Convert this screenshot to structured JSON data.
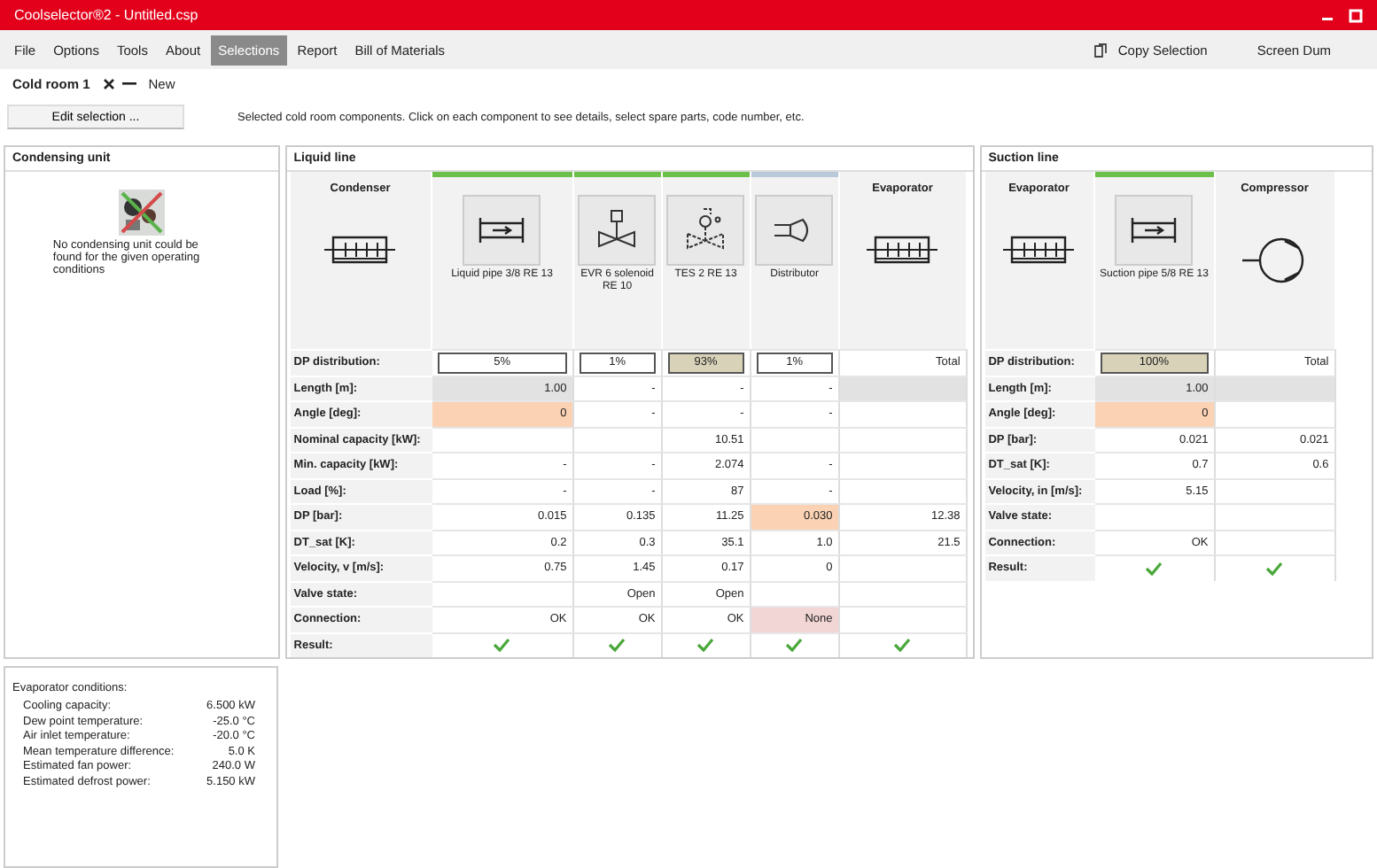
{
  "window": {
    "title": "Coolselector®2 - Untitled.csp"
  },
  "menu": [
    {
      "label": "File",
      "selected": false
    },
    {
      "label": "Options",
      "selected": false
    },
    {
      "label": "Tools",
      "selected": false
    },
    {
      "label": "About",
      "selected": false
    },
    {
      "label": "Selections",
      "selected": true
    },
    {
      "label": "Report",
      "selected": false
    },
    {
      "label": "Bill of Materials",
      "selected": false
    }
  ],
  "menu_actions": [
    "Copy Selection",
    "Screen Dum"
  ],
  "doc_tabs": [
    {
      "label": "Cold room 1",
      "selected": true
    },
    {
      "label": "New",
      "selected": false
    }
  ],
  "edit_button": "Edit selection ...",
  "hint": "Selected cold room components. Click on each component to see details, select spare parts, code number, etc.",
  "condensing_unit": {
    "title": "Condensing unit",
    "message": "No condensing unit could be found for the given operating conditions"
  },
  "sections": [
    {
      "title": "Liquid line",
      "components": [
        {
          "kind": "condenser",
          "name": "Condenser"
        },
        {
          "kind": "pipe",
          "name": "Liquid pipe 3/8 RE 13",
          "color": "#6cc04a"
        },
        {
          "kind": "valve",
          "name": "EVR 6 solenoid RE 10",
          "color": "#6cc04a"
        },
        {
          "kind": "expansion",
          "name": "TES 2 RE 13",
          "color": "#6cc04a"
        },
        {
          "kind": "distributor",
          "name": "Distributor",
          "color": "#b9c9d9"
        },
        {
          "kind": "evaporator",
          "name": "Evaporator"
        }
      ],
      "rows": [
        {
          "label": "DP distribution:",
          "cells": [
            {
              "value": "5%",
              "kind": "field"
            },
            {
              "value": "1%",
              "kind": "field"
            },
            {
              "value": "93%",
              "kind": "field",
              "color": "#d8d2b8"
            },
            {
              "value": "1%",
              "kind": "field"
            },
            {
              "value": "Total"
            }
          ]
        },
        {
          "label": "Length [m]:",
          "cells": [
            {
              "value": "1.00",
              "color": "#e2e2e2"
            },
            {
              "value": "-"
            },
            {
              "value": "-"
            },
            {
              "value": "-"
            },
            {
              "color": "#e2e2e2"
            }
          ]
        },
        {
          "label": "Angle [deg]:",
          "cells": [
            {
              "value": "0",
              "color": "#fbd3b4"
            },
            {
              "value": "-"
            },
            {
              "value": "-"
            },
            {
              "value": "-"
            },
            {}
          ]
        },
        {
          "label": "Nominal capacity [kW]:",
          "cells": [
            {},
            {},
            {
              "value": "10.51"
            },
            {},
            {}
          ]
        },
        {
          "label": "Min. capacity [kW]:",
          "cells": [
            {
              "value": "-"
            },
            {
              "value": "-"
            },
            {
              "value": "2.074"
            },
            {
              "value": "-"
            },
            {}
          ]
        },
        {
          "label": "Load [%]:",
          "cells": [
            {
              "value": "-"
            },
            {
              "value": "-"
            },
            {
              "value": "87"
            },
            {
              "value": "-"
            },
            {}
          ]
        },
        {
          "label": "DP [bar]:",
          "cells": [
            {
              "value": "0.015"
            },
            {
              "value": "0.135"
            },
            {
              "value": "11.25"
            },
            {
              "value": "0.030",
              "color": "#fbd3b4"
            },
            {
              "value": "12.38"
            }
          ]
        },
        {
          "label": "DT_sat [K]:",
          "cells": [
            {
              "value": "0.2"
            },
            {
              "value": "0.3"
            },
            {
              "value": "35.1"
            },
            {
              "value": "1.0"
            },
            {
              "value": "21.5"
            }
          ]
        },
        {
          "label": "Velocity, v [m/s]:",
          "cells": [
            {
              "value": "0.75"
            },
            {
              "value": "1.45"
            },
            {
              "value": "0.17"
            },
            {
              "value": "0"
            },
            {}
          ]
        },
        {
          "label": "Valve state:",
          "cells": [
            {},
            {
              "value": "Open"
            },
            {
              "value": "Open"
            },
            {},
            {}
          ]
        },
        {
          "label": "Connection:",
          "cells": [
            {
              "value": "OK"
            },
            {
              "value": "OK"
            },
            {
              "value": "OK"
            },
            {
              "value": "None",
              "color": "#f2d6d6"
            },
            {}
          ]
        },
        {
          "label": "Result:",
          "cells": [
            {
              "kind": "check"
            },
            {
              "kind": "check"
            },
            {
              "kind": "check"
            },
            {
              "kind": "check"
            },
            {
              "kind": "check"
            }
          ]
        }
      ]
    },
    {
      "title": "Suction line",
      "components": [
        {
          "kind": "evaporator",
          "name": "Evaporator"
        },
        {
          "kind": "pipe",
          "name": "Suction pipe 5/8 RE 13",
          "color": "#6cc04a"
        },
        {
          "kind": "compressor",
          "name": "Compressor"
        }
      ],
      "rows": [
        {
          "label": "DP distribution:",
          "cells": [
            {
              "value": "100%",
              "kind": "field",
              "color": "#d8d2b8"
            },
            {
              "value": "Total"
            }
          ]
        },
        {
          "label": "Length [m]:",
          "cells": [
            {
              "value": "1.00",
              "color": "#e2e2e2"
            },
            {
              "color": "#e2e2e2"
            }
          ]
        },
        {
          "label": "Angle [deg]:",
          "cells": [
            {
              "value": "0",
              "color": "#fbd3b4"
            },
            {}
          ]
        },
        {
          "label": "DP [bar]:",
          "cells": [
            {
              "value": "0.021"
            },
            {
              "value": "0.021"
            }
          ]
        },
        {
          "label": "DT_sat [K]:",
          "cells": [
            {
              "value": "0.7"
            },
            {
              "value": "0.6"
            }
          ]
        },
        {
          "label": "Velocity, in [m/s]:",
          "cells": [
            {
              "value": "5.15"
            },
            {}
          ]
        },
        {
          "label": "Valve state:",
          "cells": [
            {},
            {}
          ]
        },
        {
          "label": "Connection:",
          "cells": [
            {
              "value": "OK"
            },
            {}
          ]
        },
        {
          "label": "Result:",
          "cells": [
            {
              "kind": "check"
            },
            {
              "kind": "check"
            }
          ]
        }
      ]
    }
  ],
  "evaporator_conditions": {
    "title": "Evaporator conditions:",
    "items": [
      {
        "label": "Cooling capacity:",
        "value": "6.500 kW"
      },
      {
        "label": "Dew point temperature:",
        "value": "-25.0 °C"
      },
      {
        "label": "Air inlet temperature:",
        "value": "-20.0 °C"
      },
      {
        "label": "Mean temperature difference:",
        "value": "5.0 K"
      },
      {
        "label": "Estimated fan power:",
        "value": "240.0 W"
      },
      {
        "label": "Estimated defrost power:",
        "value": "5.150 kW"
      }
    ]
  }
}
